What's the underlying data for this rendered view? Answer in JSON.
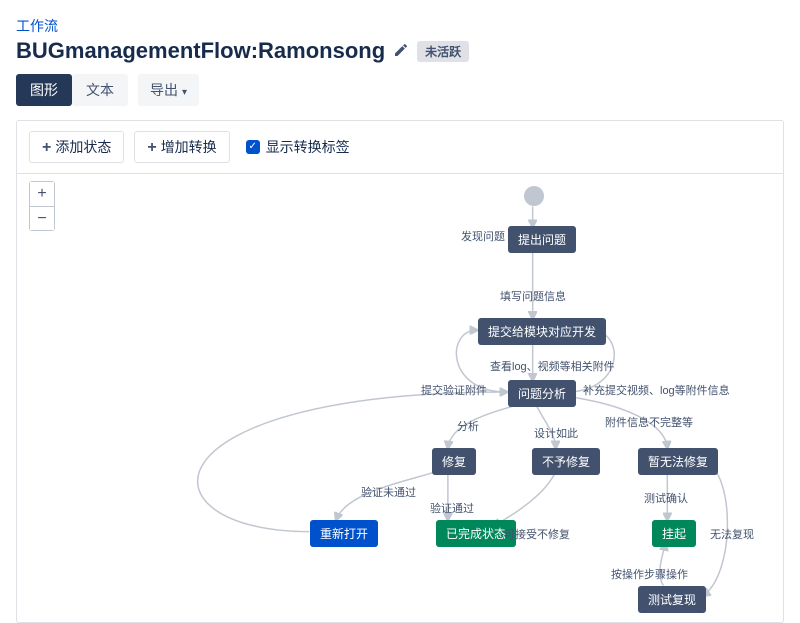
{
  "breadcrumb": "工作流",
  "title": "BUGmanagementFlow:Ramonsong",
  "status_badge": "未活跃",
  "tabs": {
    "graph": "图形",
    "text": "文本"
  },
  "export_label": "导出",
  "canvas_toolbar": {
    "add_status": "添加状态",
    "add_transition": "增加转换",
    "show_labels": "显示转换标签"
  },
  "nodes": {
    "n1": "提出问题",
    "n2": "提交给模块对应开发",
    "n3": "问题分析",
    "n4": "修复",
    "n5": "不予修复",
    "n6": "暂无法修复",
    "n7": "重新打开",
    "n8": "已完成状态",
    "n9": "挂起",
    "n10": "测试复现"
  },
  "edges": {
    "e_start": "发现问题",
    "e1": "填写问题信息",
    "e2": "查看log、视频等相关附件",
    "e3": "提交验证附件",
    "e4": "补充提交视频、log等附件信息",
    "e5": "分析",
    "e6": "设计如此",
    "e7": "附件信息不完整等",
    "e8": "验证未通过",
    "e9": "验证通过",
    "e10": "可接受不修复",
    "e11": "测试确认",
    "e12": "无法复现",
    "e13": "按操作步骤操作"
  },
  "chart_data": {
    "type": "workflow",
    "title": "BUGmanagementFlow:Ramonsong",
    "start": "start",
    "nodes": [
      {
        "id": "start",
        "kind": "initial"
      },
      {
        "id": "n1",
        "label": "提出问题",
        "kind": "status"
      },
      {
        "id": "n2",
        "label": "提交给模块对应开发",
        "kind": "status"
      },
      {
        "id": "n3",
        "label": "问题分析",
        "kind": "status"
      },
      {
        "id": "n4",
        "label": "修复",
        "kind": "status"
      },
      {
        "id": "n5",
        "label": "不予修复",
        "kind": "status"
      },
      {
        "id": "n6",
        "label": "暂无法修复",
        "kind": "status"
      },
      {
        "id": "n7",
        "label": "重新打开",
        "kind": "status",
        "color": "blue"
      },
      {
        "id": "n8",
        "label": "已完成状态",
        "kind": "status",
        "color": "green"
      },
      {
        "id": "n9",
        "label": "挂起",
        "kind": "status",
        "color": "green"
      },
      {
        "id": "n10",
        "label": "测试复现",
        "kind": "status"
      }
    ],
    "edges": [
      {
        "from": "start",
        "to": "n1",
        "label": "发现问题"
      },
      {
        "from": "n1",
        "to": "n2",
        "label": "填写问题信息"
      },
      {
        "from": "n2",
        "to": "n3",
        "label": "查看log、视频等相关附件"
      },
      {
        "from": "n3",
        "to": "n2",
        "label": "提交验证附件"
      },
      {
        "from": "n3",
        "to": "n2",
        "label": "补充提交视频、log等附件信息"
      },
      {
        "from": "n3",
        "to": "n4",
        "label": "分析"
      },
      {
        "from": "n3",
        "to": "n5",
        "label": "设计如此"
      },
      {
        "from": "n3",
        "to": "n6",
        "label": "附件信息不完整等"
      },
      {
        "from": "n4",
        "to": "n7",
        "label": "验证未通过"
      },
      {
        "from": "n4",
        "to": "n8",
        "label": "验证通过"
      },
      {
        "from": "n5",
        "to": "n8",
        "label": "可接受不修复"
      },
      {
        "from": "n6",
        "to": "n9",
        "label": "测试确认"
      },
      {
        "from": "n6",
        "to": "n10",
        "label": "无法复现"
      },
      {
        "from": "n10",
        "to": "n9",
        "label": "按操作步骤操作"
      }
    ]
  }
}
